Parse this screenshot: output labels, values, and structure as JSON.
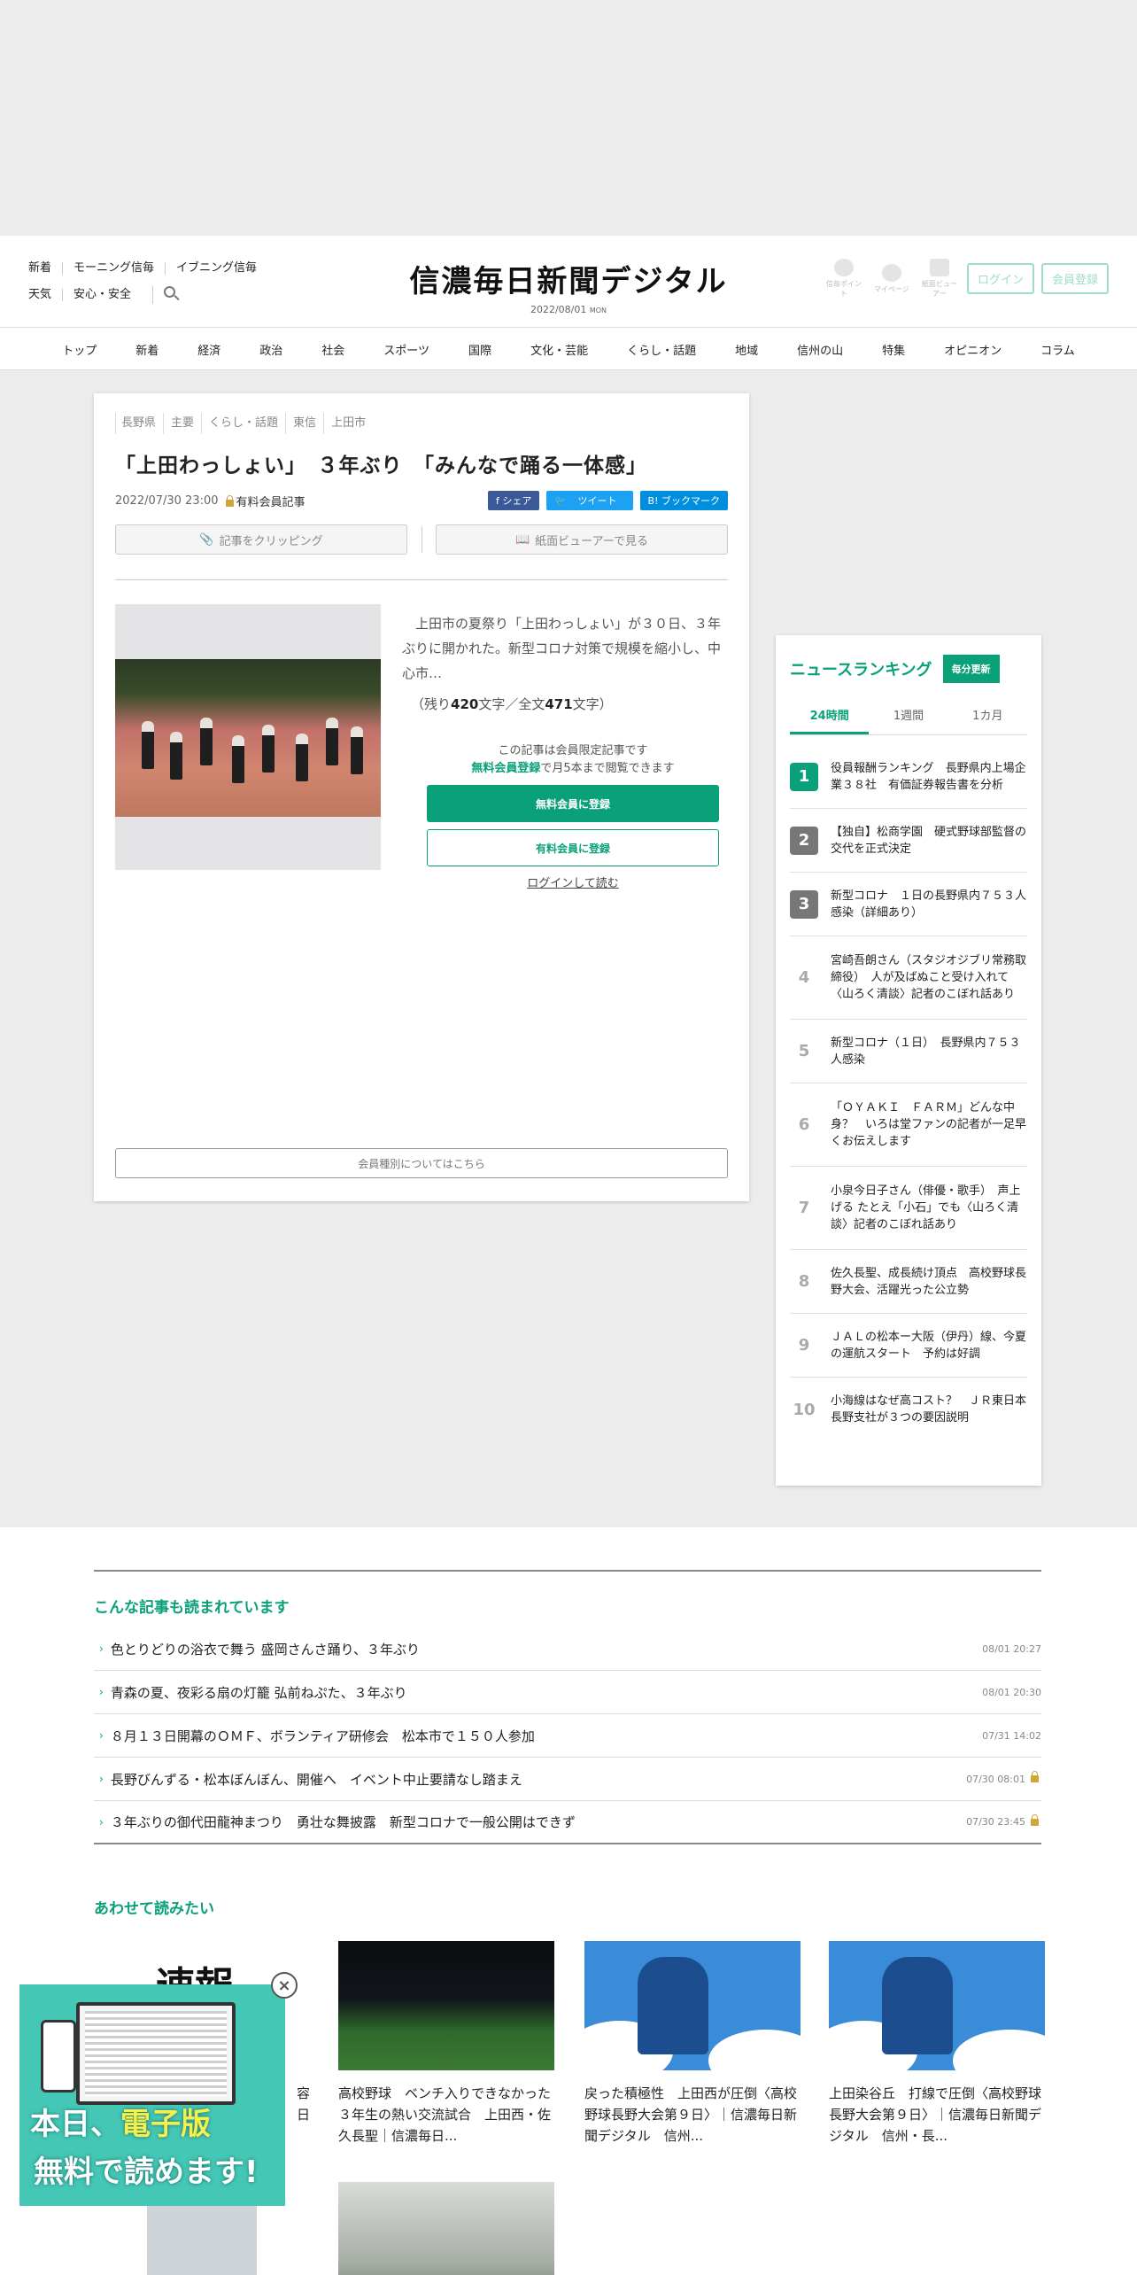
{
  "header": {
    "left_row1": [
      "新着",
      "モーニング信毎",
      "イブニング信毎"
    ],
    "left_row2": [
      "天気",
      "安心・安全"
    ],
    "logo": "信濃毎日新聞デジタル",
    "date": "2022/08/01",
    "weekday": "MON",
    "icons": [
      {
        "icon": "digital-point-icon",
        "label": "信毎ポイント"
      },
      {
        "icon": "mypage-icon",
        "label": "マイページ"
      },
      {
        "icon": "paper-viewer-icon",
        "label": "紙面ビューアー"
      }
    ],
    "login_label": "ログイン",
    "register_label": "会員登録"
  },
  "nav": [
    "トップ",
    "新着",
    "経済",
    "政治",
    "社会",
    "スポーツ",
    "国際",
    "文化・芸能",
    "くらし・話題",
    "地域",
    "信州の山",
    "特集",
    "オピニオン",
    "コラム"
  ],
  "article": {
    "breadcrumb": [
      "長野県",
      "主要",
      "くらし・話題",
      "東信",
      "上田市"
    ],
    "title": "「上田わっしょい」　３年ぶり　「みんなで踊る一体感」",
    "date": "2022/07/30 23:00",
    "paid_label": "有料会員記事",
    "share": {
      "fb": "f シェア",
      "tw": "ツイート",
      "hb": "B! ブックマーク"
    },
    "clip_label": "記事をクリッピング",
    "viewer_label": "紙面ビューアーで見る",
    "excerpt": "上田市の夏祭り「上田わっしょい」が３０日、３年ぶりに開かれた。新型コロナ対策で規模を縮小し、中心市…",
    "remain_prefix": "（残り",
    "remain_count": "420",
    "remain_mid": "文字／全文",
    "total_count": "471",
    "remain_suffix": "文字）",
    "member_note_1": "この記事は会員限定記事です",
    "member_note_free": "無料会員登録",
    "member_note_2": "で月5本まで閲覧できます",
    "free_register": "無料会員に登録",
    "paid_register": "有料会員に登録",
    "login_read": "ログインして読む",
    "member_type": "会員種別についてはこちら"
  },
  "ranking": {
    "title": "ニュースランキング",
    "badge": "毎分更新",
    "tabs": [
      "24時間",
      "1週間",
      "1カ月"
    ],
    "items": [
      {
        "rank": "1",
        "text": "役員報酬ランキング　長野県内上場企業３８社　有価証券報告書を分析"
      },
      {
        "rank": "2",
        "text": "【独自】松商学園　硬式野球部監督の交代を正式決定"
      },
      {
        "rank": "3",
        "text": "新型コロナ　１日の長野県内７５３人感染（詳細あり）"
      },
      {
        "rank": "4",
        "text": "宮崎吾朗さん（スタジオジブリ常務取締役）　人が及ばぬこと受け入れて〈山ろく清談〉記者のこぼれ話あり"
      },
      {
        "rank": "5",
        "text": "新型コロナ（１日）　長野県内７５３人感染"
      },
      {
        "rank": "6",
        "text": "「ＯＹＡＫＩ　ＦＡＲＭ」どんな中身？　いろは堂ファンの記者が一足早くお伝えします"
      },
      {
        "rank": "7",
        "text": "小泉今日子さん（俳優・歌手）　声上げる たとえ「小石」でも〈山ろく清談〉記者のこぼれ話あり"
      },
      {
        "rank": "8",
        "text": "佐久長聖、成長続け頂点　高校野球長野大会、活躍光った公立勢"
      },
      {
        "rank": "9",
        "text": "ＪＡＬの松本ー大阪（伊丹）線、今夏の運航スタート　予約は好調"
      },
      {
        "rank": "10",
        "text": "小海線はなぜ高コスト？　ＪＲ東日本長野支社が３つの要因説明"
      }
    ]
  },
  "read": {
    "title": "こんな記事も読まれています",
    "items": [
      {
        "title": "色とりどりの浴衣で舞う 盛岡さんさ踊り、３年ぶり",
        "date": "08/01 20:27",
        "locked": false
      },
      {
        "title": "青森の夏、夜彩る扇の灯籠 弘前ねぷた、３年ぶり",
        "date": "08/01 20:30",
        "locked": false
      },
      {
        "title": "８月１３日開幕のＯＭＦ、ボランティア研修会　松本市で１５０人参加",
        "date": "07/31 14:02",
        "locked": false
      },
      {
        "title": "長野びんずる・松本ぼんぼん、開催へ　イベント中止要請なし踏まえ",
        "date": "07/30 08:01",
        "locked": true
      },
      {
        "title": "３年ぶりの御代田龍神まつり　勇壮な舞披露　新型コロナで一般公開はできず",
        "date": "07/30 23:45",
        "locked": true
      }
    ]
  },
  "also": {
    "title": "あわせて読みたい",
    "cards": [
      {
        "text": "高校野球　ベンチ入りできなかった３年生の熱い交流試合　上田西・佐久長聖｜信濃毎日..."
      },
      {
        "text": "戻った積極性　上田西が圧倒〈高校野球長野大会第９日〉｜信濃毎日新聞デジタル　信州..."
      },
      {
        "text": "上田染谷丘　打線で圧倒〈高校野球長野大会第９日〉｜信濃毎日新聞デジタル　信州・長..."
      }
    ],
    "partial_1": "容",
    "partial_2": "日",
    "sokuho": "速報"
  },
  "banner": {
    "line1a": "本日、",
    "line1b": "電子版",
    "line2": "無料で読めます!",
    "close": "×"
  }
}
